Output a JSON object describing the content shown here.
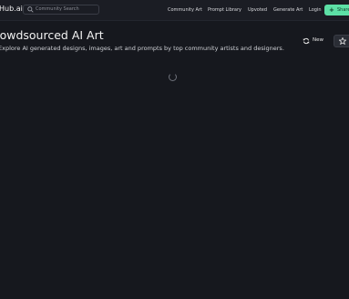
{
  "header": {
    "logo_text": "Hub.ai",
    "search": {
      "placeholder": "Community Search",
      "value": "",
      "icon": "search-icon"
    },
    "nav": [
      {
        "label": "Community Art"
      },
      {
        "label": "Prompt Library"
      },
      {
        "label": "Upvoted"
      },
      {
        "label": "Generate Art"
      },
      {
        "label": "Login"
      }
    ],
    "share_button": {
      "label": "Share",
      "icon": "plus-icon"
    }
  },
  "hero": {
    "title": "Crowdsourced AI Art",
    "subtitle": "Explore AI generated designs, images, art and prompts by top community artists and designers."
  },
  "sort": {
    "new_label": "New",
    "new_icon": "refresh-icon",
    "star_icon": "star-icon"
  },
  "content": {
    "loading_icon": "loading-spinner-icon"
  },
  "colors": {
    "background": "#16181e",
    "navbar": "#1b1d24",
    "accent": "#5de0a6"
  }
}
